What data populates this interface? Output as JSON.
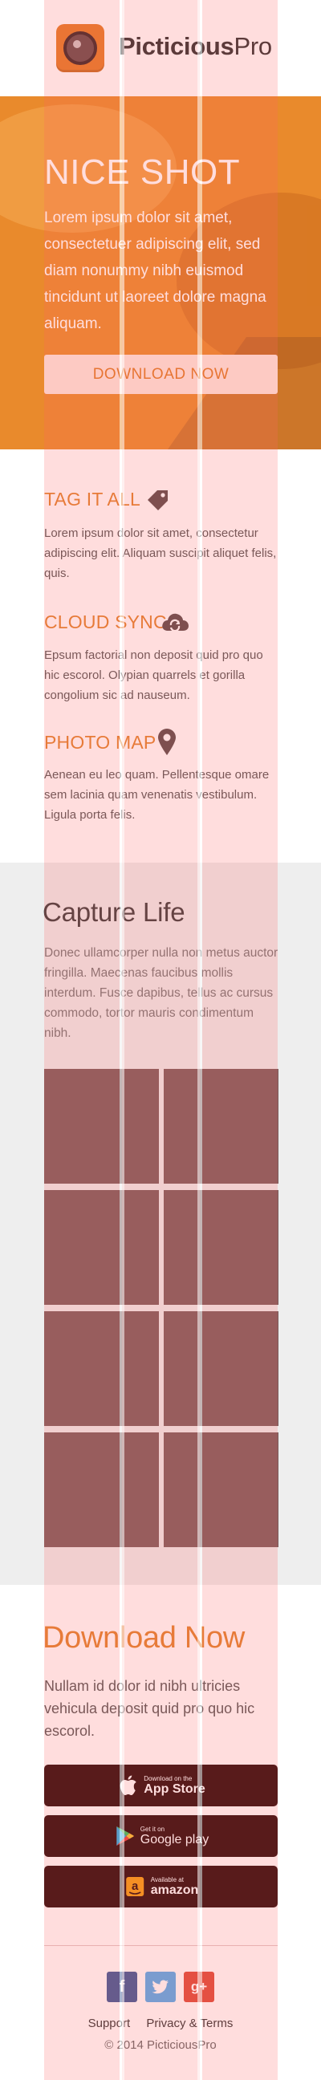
{
  "brand": {
    "name_bold": "Picticious",
    "name_regular": "Pro"
  },
  "hero": {
    "title": "NICE SHOT",
    "text": "Lorem ipsum dolor sit amet, consectetuer adipiscing elit, sed diam nonummy nibh euismod tincidunt ut laoreet dolore magna aliquam.",
    "button_label": "DOWNLOAD NOW"
  },
  "features": [
    {
      "title": "TAG IT ALL",
      "icon": "tag-icon",
      "text": "Lorem ipsum dolor sit amet, consectetur adipiscing elit. Aliquam suscipit aliquet felis, quis."
    },
    {
      "title": "CLOUD SYNC",
      "icon": "cloud-sync-icon",
      "text": "Epsum factorial non deposit quid pro quo hic escorol. Olypian quarrels et gorilla congolium sic ad nauseum."
    },
    {
      "title": "PHOTO MAP",
      "icon": "map-pin-icon",
      "text": "Aenean eu leo quam. Pellentesque omare sem lacinia quam venenatis vestibulum. Ligula porta felis."
    }
  ],
  "gallery": {
    "title": "Capture Life",
    "text": "Donec ullamcorper nulla non metus auctor fringilla. Maecenas faucibus mollis interdum. Fusce dapibus, tellus ac cursus commodo, tortor mauris condimentum nibh."
  },
  "download": {
    "title": "Download Now",
    "text": "Nullam id dolor id nibh ultricies vehicula deposit quid pro quo hic escorol.",
    "stores": [
      {
        "small": "Download on the",
        "big": "App Store",
        "icon": "apple-icon"
      },
      {
        "small": "Get it on",
        "big": "Google play",
        "icon": "google-play-icon"
      },
      {
        "small": "Available at",
        "big": "amazon",
        "icon": "amazon-icon"
      }
    ]
  },
  "social": [
    {
      "label": "f",
      "icon": "facebook-icon",
      "color": "#3b5998"
    },
    {
      "label": "",
      "icon": "twitter-icon",
      "color": "#55acee"
    },
    {
      "label": "g+",
      "icon": "google-plus-icon",
      "color": "#dd4b39"
    }
  ],
  "footer": {
    "support": "Support",
    "privacy": "Privacy & Terms",
    "copyright": "© 2014 PicticiousPro"
  },
  "colors": {
    "accent": "#e0822e",
    "hero_bg": "#e98a2c",
    "tile": "#7b5b5b",
    "store_button": "#2a0707"
  }
}
